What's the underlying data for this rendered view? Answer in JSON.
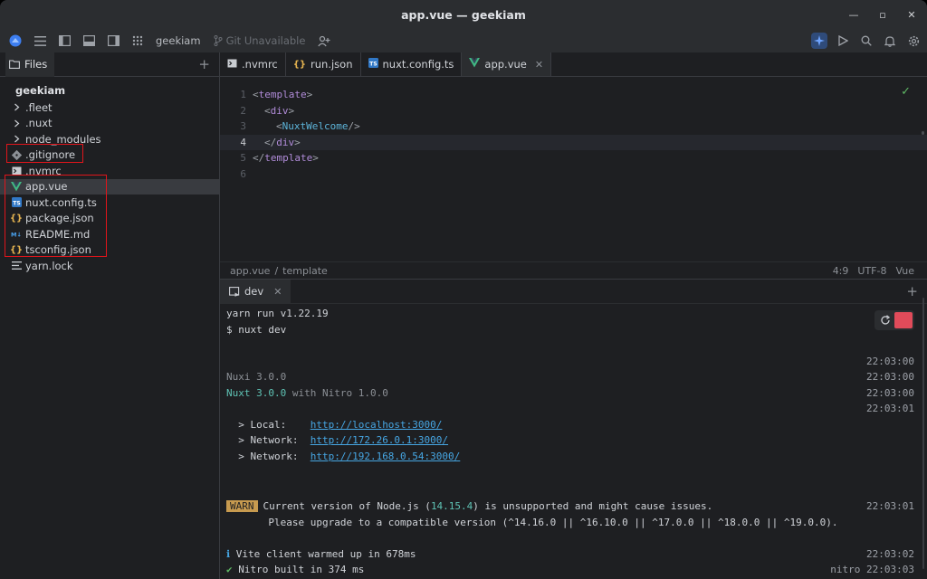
{
  "window": {
    "title": "app.vue — geekiam"
  },
  "toolbar": {
    "project": "geekiam",
    "git": "Git Unavailable"
  },
  "sidebar": {
    "header": "Files",
    "project": "geekiam",
    "items": [
      {
        "label": ".fleet",
        "type": "folder"
      },
      {
        "label": ".nuxt",
        "type": "folder"
      },
      {
        "label": "node_modules",
        "type": "folder"
      },
      {
        "label": ".gitignore",
        "type": "gitignore"
      },
      {
        "label": ".nvmrc",
        "type": "terminal"
      },
      {
        "label": "app.vue",
        "type": "vue"
      },
      {
        "label": "nuxt.config.ts",
        "type": "ts"
      },
      {
        "label": "package.json",
        "type": "json"
      },
      {
        "label": "README.md",
        "type": "md"
      },
      {
        "label": "tsconfig.json",
        "type": "json"
      },
      {
        "label": "yarn.lock",
        "type": "lock"
      }
    ]
  },
  "tabs": [
    {
      "label": ".nvmrc"
    },
    {
      "label": "run.json"
    },
    {
      "label": "nuxt.config.ts"
    },
    {
      "label": "app.vue"
    }
  ],
  "editor": {
    "line_numbers": [
      "1",
      "2",
      "3",
      "4",
      "5",
      "6"
    ],
    "code": {
      "l1_open": "<",
      "l1_tag": "template",
      "l1_close": ">",
      "l2_open": "<",
      "l2_tag": "div",
      "l2_close": ">",
      "l3_open": "<",
      "l3_comp": "NuxtWelcome",
      "l3_close": " />",
      "l4_open": "</",
      "l4_tag": "div",
      "l4_close": ">",
      "l5_open": "</",
      "l5_tag": "template",
      "l5_close": ">"
    },
    "breadcrumb": [
      "app.vue",
      "template"
    ],
    "breadcrumb_sep": "/",
    "status": {
      "position": "4:9",
      "encoding": "UTF-8",
      "language": "Vue"
    }
  },
  "terminal": {
    "tab": "dev",
    "lines": {
      "l1": "yarn run v1.22.19",
      "l2": "$ nuxt dev",
      "ts1": "22:03:00",
      "nuxi": "Nuxi 3.0.0",
      "ts2": "22:03:00",
      "nuxt_a": "Nuxt 3.0.0",
      "nuxt_b": " with Nitro 1.0.0",
      "ts3": "22:03:00",
      "ts4": "22:03:01",
      "local_label": "  > Local:    ",
      "local_url": "http://localhost:3000/",
      "net1_label": "  > Network:  ",
      "net1_url": "http://172.26.0.1:3000/",
      "net2_label": "  > Network:  ",
      "net2_url": "http://192.168.0.54:3000/",
      "warn": "WARN",
      "warn_a": "Current version of Node.js (",
      "warn_ver": "14.15.4",
      "warn_b": ") is unsupported and might cause issues.",
      "ts5": "22:03:01",
      "warn_line2": "       Please upgrade to a compatible version (^14.16.0 || ^16.10.0 || ^17.0.0 || ^18.0.0 || ^19.0.0).",
      "vite_icon": "ℹ",
      "vite": " Vite client warmed up in 678ms",
      "ts6": "22:03:02",
      "nitro_icon": "✔",
      "nitro": " Nitro built in 374 ms",
      "ts7": "nitro 22:03:03"
    }
  }
}
